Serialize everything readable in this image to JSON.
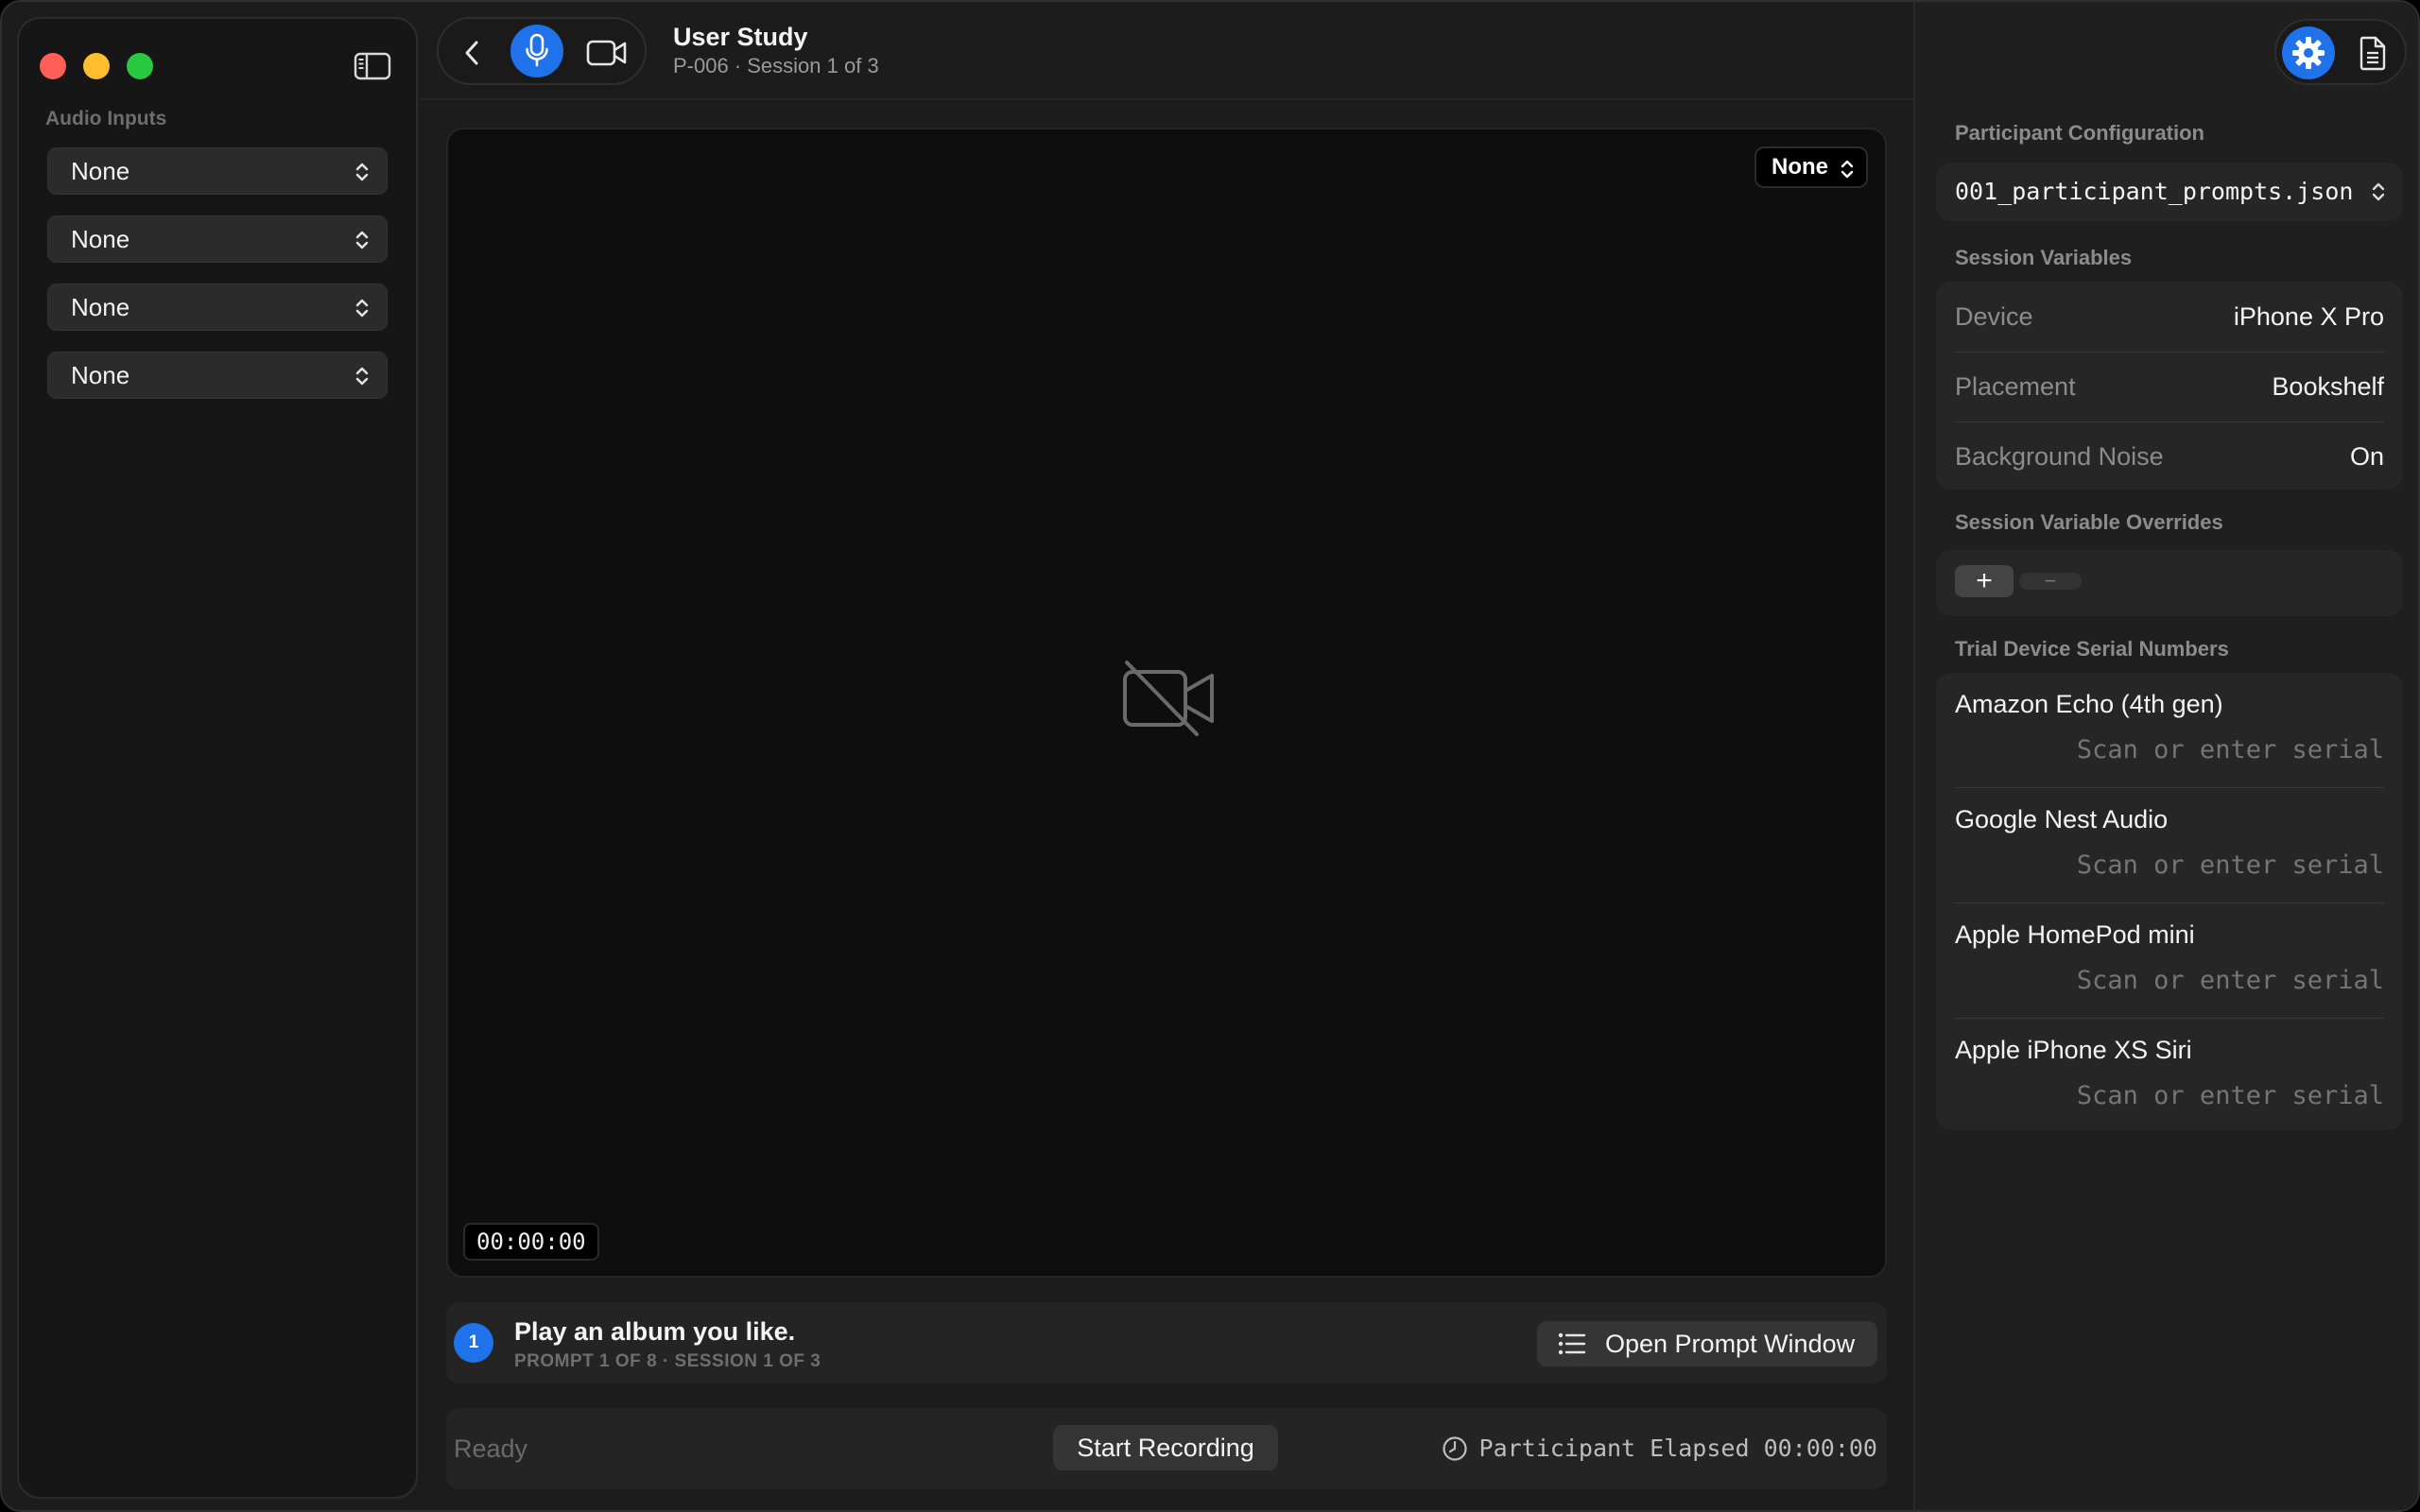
{
  "window": {
    "title": "User Study",
    "subtitle": "P-006 · Session 1 of 3"
  },
  "sidebar": {
    "section_label": "Audio Inputs",
    "audio_inputs": [
      {
        "value": "None"
      },
      {
        "value": "None"
      },
      {
        "value": "None"
      },
      {
        "value": "None"
      }
    ]
  },
  "toolbar": {
    "back_icon": "chevron-left-icon",
    "mic_icon": "microphone-icon",
    "camera_icon": "video-camera-icon",
    "mic_active_color": "#1f72ea"
  },
  "video": {
    "camera_select": "None",
    "placeholder_icon": "video-off-icon",
    "timecode": "00:00:00"
  },
  "prompt": {
    "number": "1",
    "text": "Play an album you like.",
    "meta": "PROMPT 1 OF 8 · SESSION 1 OF 3",
    "open_button": "Open Prompt Window"
  },
  "status": {
    "state": "Ready",
    "record_button": "Start Recording",
    "elapsed_label": "Participant Elapsed",
    "elapsed_time": "00:00:00"
  },
  "inspector": {
    "participant_config_label": "Participant Configuration",
    "participant_config_file": "001_participant_prompts.json",
    "session_variables_label": "Session Variables",
    "session_variables": [
      {
        "key": "Device",
        "value": "iPhone X Pro"
      },
      {
        "key": "Placement",
        "value": "Bookshelf"
      },
      {
        "key": "Background Noise",
        "value": "On"
      }
    ],
    "overrides_label": "Session Variable Overrides",
    "add_label": "+",
    "remove_label": "−",
    "serials_label": "Trial Device Serial Numbers",
    "serial_placeholder": "Scan or enter serial",
    "devices": [
      {
        "name": "Amazon Echo (4th gen)"
      },
      {
        "name": "Google Nest Audio"
      },
      {
        "name": "Apple HomePod mini"
      },
      {
        "name": "Apple iPhone XS Siri"
      }
    ]
  }
}
